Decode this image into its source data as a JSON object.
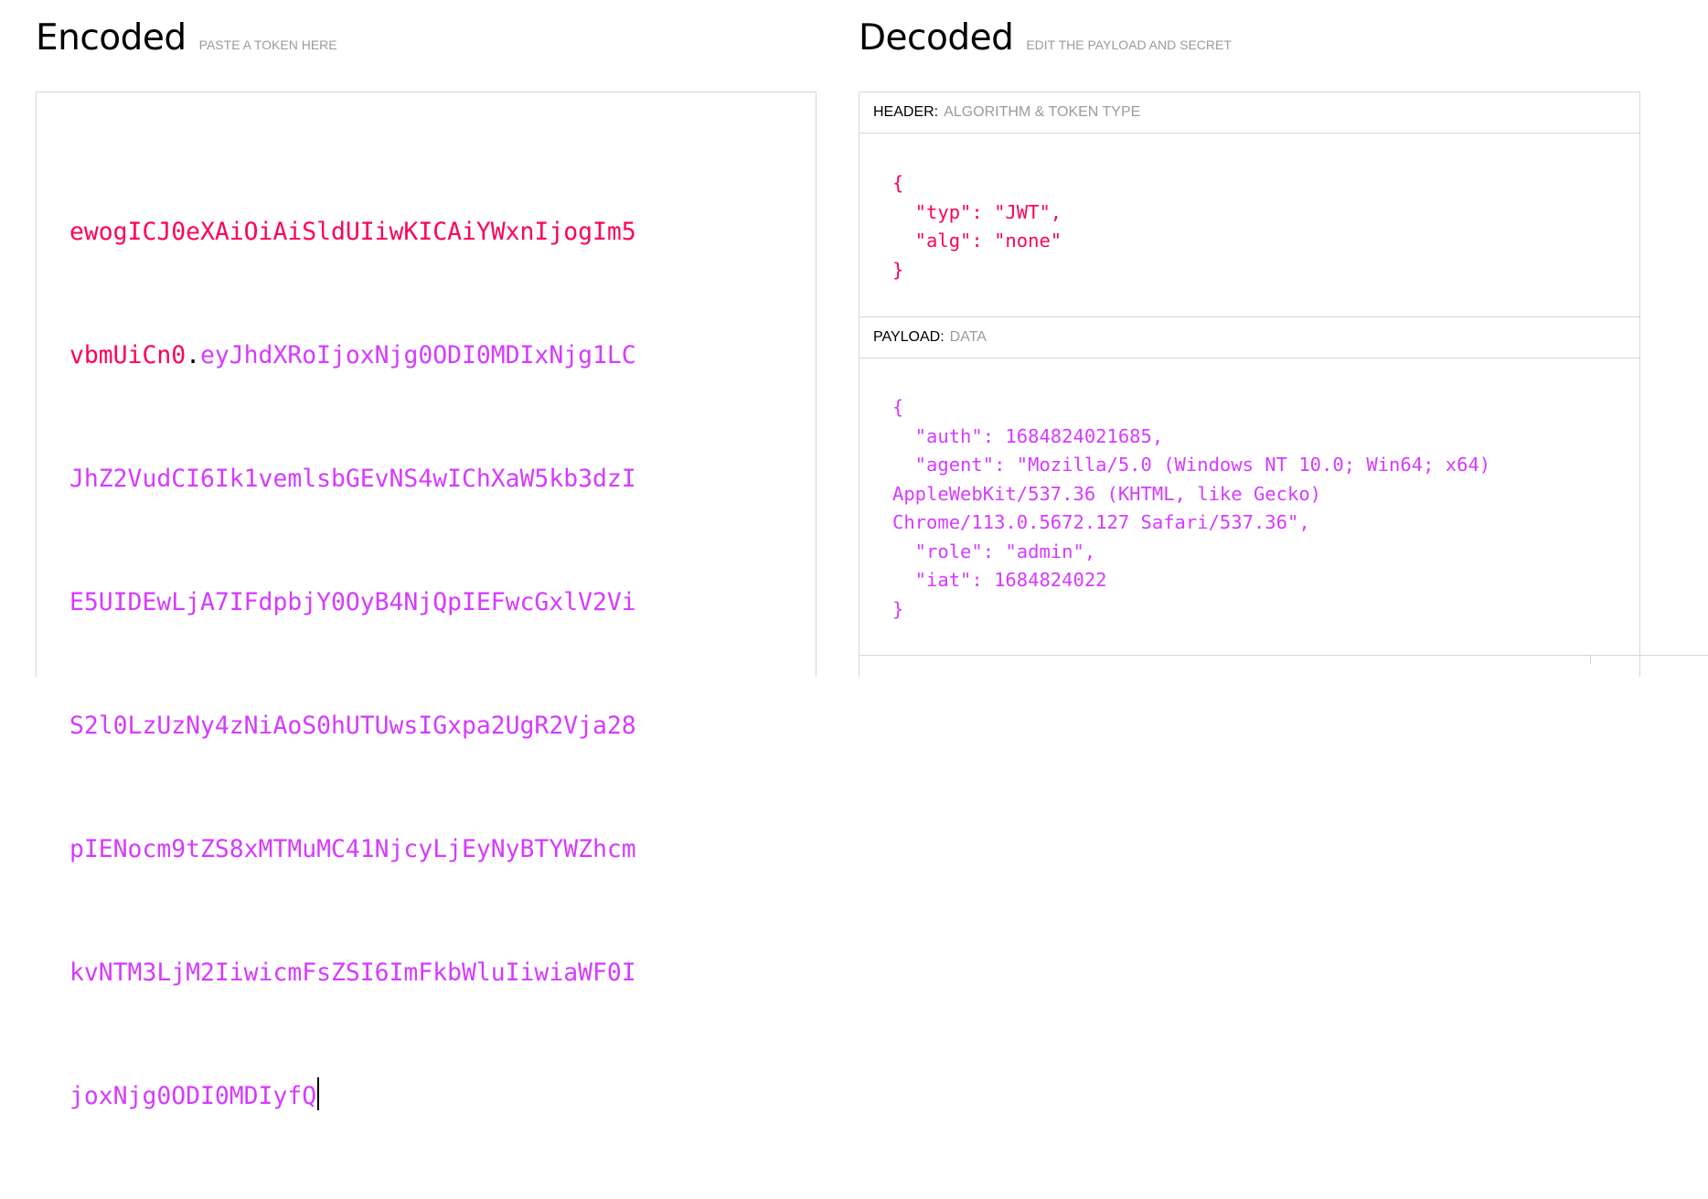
{
  "encoded": {
    "title": "Encoded",
    "subtitle": "PASTE A TOKEN HERE",
    "token_lines": [
      {
        "header": "ewogICJ0eXAiOiAiSldUIiwKICAiYWxnIjogIm5",
        "dot": "",
        "payload": ""
      },
      {
        "header": "vbmUiCn0",
        "dot": ".",
        "payload": "eyJhdXRoIjoxNjg0ODI0MDIxNjg1LC"
      },
      {
        "header": "",
        "dot": "",
        "payload": "JhZ2VudCI6Ik1vemlsbGEvNS4wIChXaW5kb3dzI"
      },
      {
        "header": "",
        "dot": "",
        "payload": "E5UIDEwLjA7IFdpbjY0OyB4NjQpIEFwcGxlV2Vi"
      },
      {
        "header": "",
        "dot": "",
        "payload": "S2l0LzUzNy4zNiAoS0hUTUwsIGxpa2UgR2Vja28"
      },
      {
        "header": "",
        "dot": "",
        "payload": "pIENocm9tZS8xMTMuMC41NjcyLjEyNyBTYWZhcm"
      },
      {
        "header": "",
        "dot": "",
        "payload": "kvNTM3LjM2IiwicmFsZSI6ImFkbWluIiwiaWF0I"
      },
      {
        "header": "",
        "dot": "",
        "payload": "joxNjg0ODI0MDIyfQ"
      }
    ]
  },
  "decoded": {
    "title": "Decoded",
    "subtitle": "EDIT THE PAYLOAD AND SECRET",
    "header_section": {
      "label": "HEADER:",
      "desc": "ALGORITHM & TOKEN TYPE",
      "code": "{\n  \"typ\": \"JWT\",\n  \"alg\": \"none\"\n}"
    },
    "payload_section": {
      "label": "PAYLOAD:",
      "desc": "DATA",
      "code": "{\n  \"auth\": 1684824021685,\n  \"agent\": \"Mozilla/5.0 (Windows NT 10.0; Win64; x64)\nAppleWebKit/537.36 (KHTML, like Gecko)\nChrome/113.0.5672.127 Safari/537.36\",\n  \"role\": \"admin\",\n  \"iat\": 1684824022\n}"
    }
  },
  "colors": {
    "header": "#fb015b",
    "payload": "#d63aff",
    "muted": "#9b9b9b",
    "border": "#d6d6d6"
  }
}
